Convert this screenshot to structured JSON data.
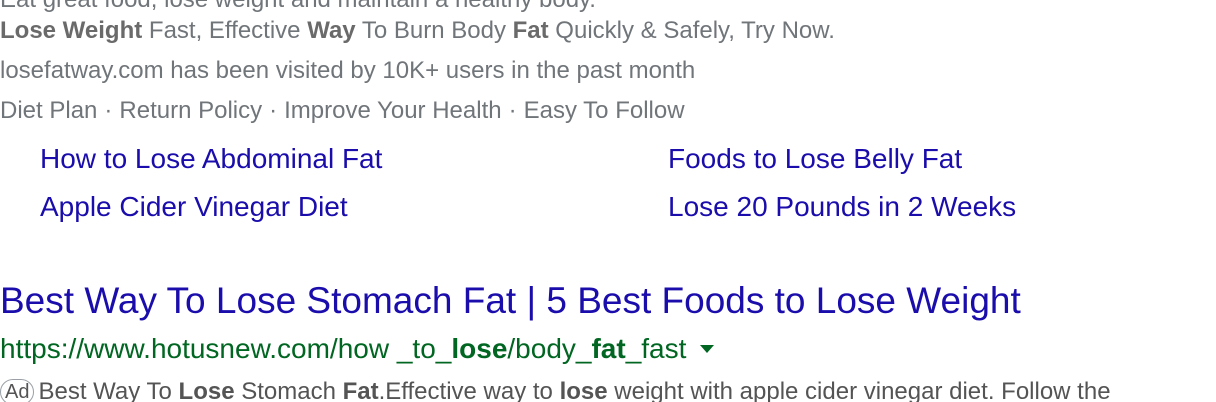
{
  "top_ad": {
    "clipped_line": "Eat great food, lose weight and maintain a healthy body.",
    "description_parts": [
      {
        "text": "Lose Weight",
        "bold": true
      },
      {
        "text": " Fast, Effective ",
        "bold": false
      },
      {
        "text": "Way",
        "bold": true
      },
      {
        "text": " To Burn Body ",
        "bold": false
      },
      {
        "text": "Fat",
        "bold": true
      },
      {
        "text": " Quickly & Safely, Try Now.",
        "bold": false
      }
    ],
    "visited_note": "losefatway.com has been visited by 10K+ users in the past month",
    "inline_sitelinks": [
      "Diet Plan",
      "Return Policy",
      "Improve Your Health",
      "Easy To Follow"
    ],
    "inline_separator": "·",
    "sitelinks": [
      "How to Lose Abdominal Fat",
      "Foods to Lose Belly Fat",
      "Apple Cider Vinegar Diet",
      "Lose 20 Pounds in 2 Weeks"
    ]
  },
  "second_ad": {
    "title": "Best Way To Lose Stomach Fat | 5 Best Foods to Lose Weight",
    "url_parts": [
      {
        "text": "https://www.hotusnew.com/how _to_",
        "bold": false
      },
      {
        "text": "lose",
        "bold": true
      },
      {
        "text": "/body_",
        "bold": false
      },
      {
        "text": "fat",
        "bold": true
      },
      {
        "text": "_fast",
        "bold": false
      }
    ],
    "ad_badge": "Ad",
    "description_parts": [
      {
        "text": "Best Way To ",
        "bold": false
      },
      {
        "text": "Lose",
        "bold": true
      },
      {
        "text": " Stomach ",
        "bold": false
      },
      {
        "text": "Fat",
        "bold": true
      },
      {
        "text": ".Effective way to ",
        "bold": false
      },
      {
        "text": "lose",
        "bold": true
      },
      {
        "text": " weight with apple cider vinegar diet. Follow the",
        "bold": false
      }
    ]
  },
  "colors": {
    "link": "#1a0dab",
    "url_green": "#006621",
    "muted_text": "#70757a"
  }
}
